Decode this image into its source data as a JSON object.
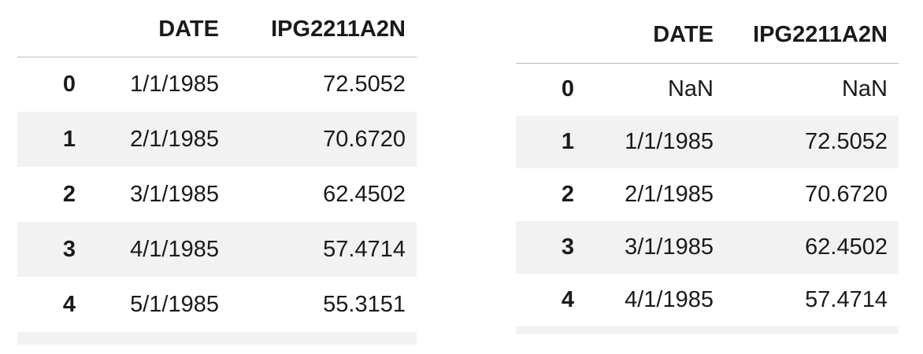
{
  "tables": [
    {
      "columns": [
        "",
        "DATE",
        "IPG2211A2N"
      ],
      "rows": [
        {
          "index": "0",
          "date": "1/1/1985",
          "value": "72.5052"
        },
        {
          "index": "1",
          "date": "2/1/1985",
          "value": "70.6720"
        },
        {
          "index": "2",
          "date": "3/1/1985",
          "value": "62.4502"
        },
        {
          "index": "3",
          "date": "4/1/1985",
          "value": "57.4714"
        },
        {
          "index": "4",
          "date": "5/1/1985",
          "value": "55.3151"
        }
      ]
    },
    {
      "columns": [
        "",
        "DATE",
        "IPG2211A2N"
      ],
      "rows": [
        {
          "index": "0",
          "date": "NaN",
          "value": "NaN"
        },
        {
          "index": "1",
          "date": "1/1/1985",
          "value": "72.5052"
        },
        {
          "index": "2",
          "date": "2/1/1985",
          "value": "70.6720"
        },
        {
          "index": "3",
          "date": "3/1/1985",
          "value": "62.4502"
        },
        {
          "index": "4",
          "date": "4/1/1985",
          "value": "57.4714"
        }
      ]
    }
  ]
}
